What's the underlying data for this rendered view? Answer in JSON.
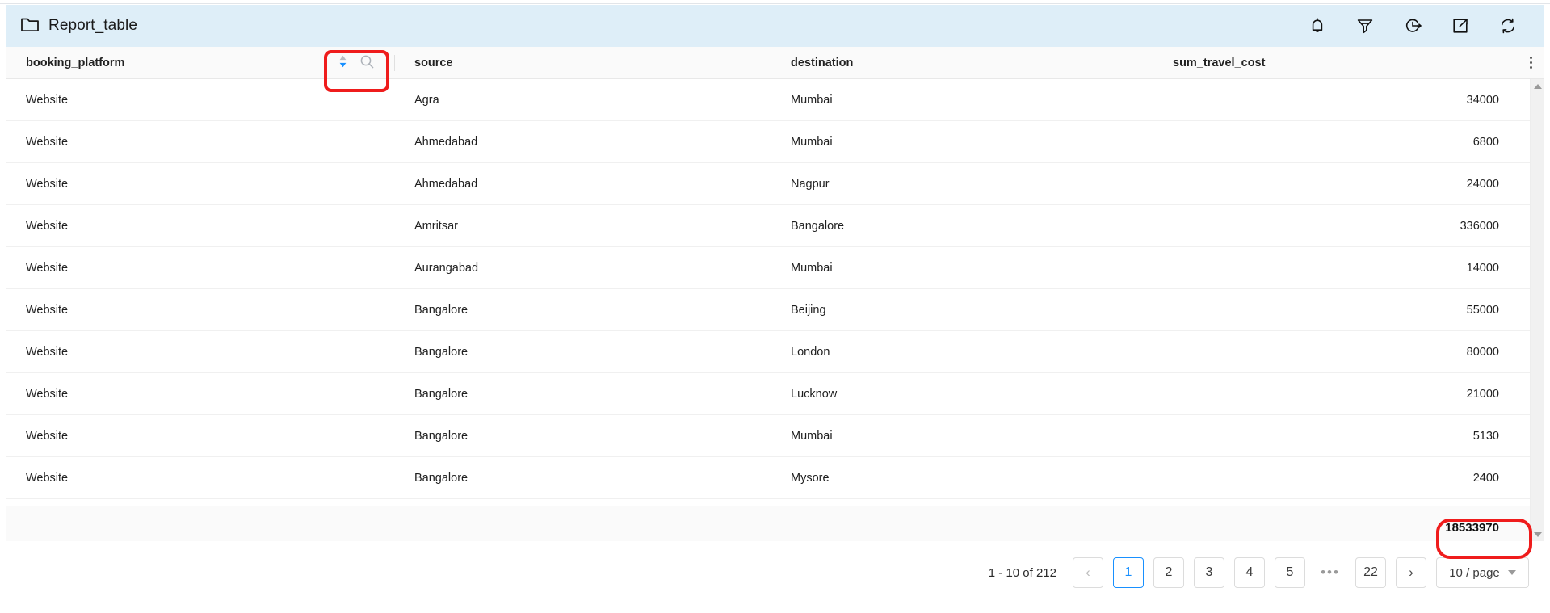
{
  "header": {
    "title": "Report_table",
    "folder_icon": "folder-icon",
    "background_color": "#deeef8",
    "actions": [
      {
        "name": "notification-bell-icon",
        "label": "Notifications"
      },
      {
        "name": "filter-funnel-icon",
        "label": "Filter"
      },
      {
        "name": "schedule-clock-icon",
        "label": "Schedule"
      },
      {
        "name": "export-icon",
        "label": "Export"
      },
      {
        "name": "refresh-icon",
        "label": "Refresh"
      }
    ]
  },
  "table": {
    "columns": [
      {
        "key": "booking_platform",
        "label": "booking_platform",
        "align": "left"
      },
      {
        "key": "source",
        "label": "source",
        "align": "left"
      },
      {
        "key": "destination",
        "label": "destination",
        "align": "left"
      },
      {
        "key": "sum_travel_cost",
        "label": "sum_travel_cost",
        "align": "right"
      }
    ],
    "column_tools": {
      "sort_icon": "sort-icon",
      "sort_state": "descending",
      "search_icon": "search-icon"
    },
    "overflow_menu_icon": "more-vertical-icon",
    "rows": [
      {
        "booking_platform": "Website",
        "source": "Agra",
        "destination": "Mumbai",
        "sum_travel_cost": "34000"
      },
      {
        "booking_platform": "Website",
        "source": "Ahmedabad",
        "destination": "Mumbai",
        "sum_travel_cost": "6800"
      },
      {
        "booking_platform": "Website",
        "source": "Ahmedabad",
        "destination": "Nagpur",
        "sum_travel_cost": "24000"
      },
      {
        "booking_platform": "Website",
        "source": "Amritsar",
        "destination": "Bangalore",
        "sum_travel_cost": "336000"
      },
      {
        "booking_platform": "Website",
        "source": "Aurangabad",
        "destination": "Mumbai",
        "sum_travel_cost": "14000"
      },
      {
        "booking_platform": "Website",
        "source": "Bangalore",
        "destination": "Beijing",
        "sum_travel_cost": "55000"
      },
      {
        "booking_platform": "Website",
        "source": "Bangalore",
        "destination": "London",
        "sum_travel_cost": "80000"
      },
      {
        "booking_platform": "Website",
        "source": "Bangalore",
        "destination": "Lucknow",
        "sum_travel_cost": "21000"
      },
      {
        "booking_platform": "Website",
        "source": "Bangalore",
        "destination": "Mumbai",
        "sum_travel_cost": "5130"
      },
      {
        "booking_platform": "Website",
        "source": "Bangalore",
        "destination": "Mysore",
        "sum_travel_cost": "2400"
      }
    ],
    "summary": {
      "booking_platform": "",
      "source": "",
      "destination": "",
      "sum_travel_cost": "18533970"
    }
  },
  "pagination": {
    "range_text": "1 - 10 of 212",
    "prev_label": "‹",
    "next_label": "›",
    "pages": [
      "1",
      "2",
      "3",
      "4",
      "5"
    ],
    "ellipsis": "•••",
    "last_page": "22",
    "active_page": "1",
    "page_size_label": "10 / page"
  },
  "annotations": {
    "accent_color": "#ef1c1c",
    "highlight_sort_tools": "sort-and-search-controls",
    "highlight_total": "18533970"
  }
}
